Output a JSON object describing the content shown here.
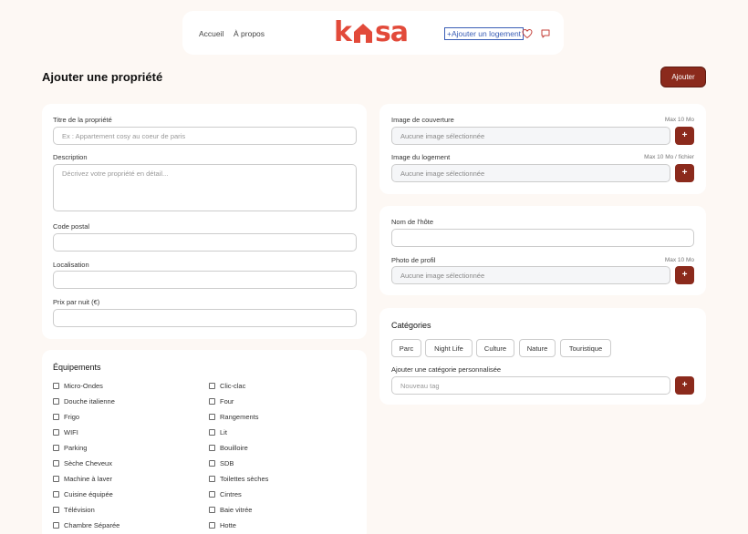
{
  "nav": {
    "home": "Accueil",
    "about": "À propos",
    "logo": "kasa",
    "add_listing": "+Ajouter un logement",
    "favorites_icon": "heart-icon",
    "messages_icon": "chat-bubble-icon"
  },
  "page": {
    "title": "Ajouter une propriété",
    "submit_label": "Ajouter"
  },
  "property_form": {
    "title_label": "Titre de la propriété",
    "title_placeholder": "Ex : Appartement cosy au coeur de paris",
    "title_value": "",
    "description_label": "Description",
    "description_placeholder": "Décrivez votre propriété en détail...",
    "postal_label": "Code postal",
    "location_label": "Localisation",
    "price_label": "Prix par nuit (€)"
  },
  "images": {
    "cover_label": "Image de couverture",
    "cover_hint": "Max 10 Mo",
    "cover_value": "Aucune image sélectionnée",
    "gallery_label": "Image du logement",
    "gallery_hint": "Max 10 Mo / fichier",
    "gallery_value": "Aucune image sélectionnée",
    "add_symbol": "+"
  },
  "host": {
    "name_label": "Nom de l'hôte",
    "photo_label": "Photo de profil",
    "photo_hint": "Max 10 Mo",
    "photo_value": "Aucune image sélectionnée"
  },
  "categories": {
    "title": "Catégories",
    "items": [
      "Parc",
      "Night Life",
      "Culture",
      "Nature",
      "Touristique"
    ],
    "custom_label": "Ajouter une catégorie personnalisée",
    "custom_placeholder": "Nouveau tag"
  },
  "equipments": {
    "title": "Équipements",
    "left": [
      "Micro-Ondes",
      "Douche italienne",
      "Frigo",
      "WIFI",
      "Parking",
      "Sèche Cheveux",
      "Machine à laver",
      "Cuisine équipée",
      "Télévision",
      "Chambre Séparée"
    ],
    "right": [
      "Clic-clac",
      "Four",
      "Rangements",
      "Lit",
      "Bouilloire",
      "SDB",
      "Toilettes sèches",
      "Cintres",
      "Baie vitrée",
      "Hotte"
    ]
  },
  "colors": {
    "brand": "#e24a3a",
    "primary_button": "#8b2a1c",
    "background": "#fdf8f4"
  }
}
